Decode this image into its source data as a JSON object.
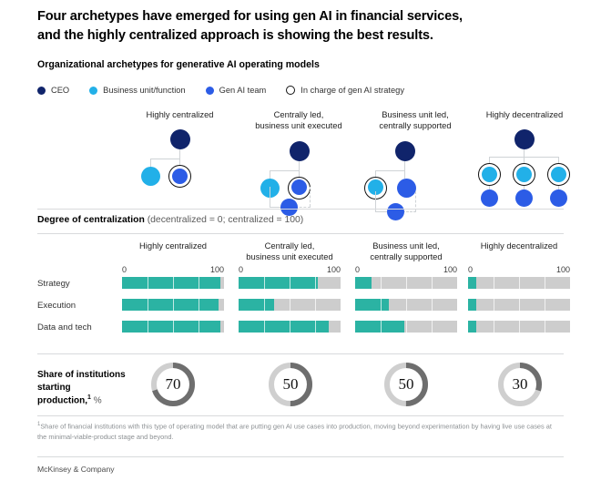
{
  "headline": {
    "line1": "Four archetypes have emerged for using gen AI in financial services,",
    "line2": "and the highly centralized approach is showing the best results."
  },
  "section1": {
    "title": "Organizational archetypes for generative AI operating models",
    "legend": [
      {
        "label": "CEO",
        "color": "#10246b",
        "style": "solid"
      },
      {
        "label": "Business unit/function",
        "color": "#22b0e8",
        "style": "solid"
      },
      {
        "label": "Gen AI team",
        "color": "#2c5ce6",
        "style": "solid"
      },
      {
        "label": "In charge of gen AI strategy",
        "color": "#ffffff",
        "style": "ring"
      }
    ],
    "archetypes": [
      {
        "name": "Highly centralized",
        "label_line1": "Highly centralized",
        "label_line2": ""
      },
      {
        "name": "Centrally led, business unit executed",
        "label_line1": "Centrally led,",
        "label_line2": "business unit executed"
      },
      {
        "name": "Business unit led, centrally supported",
        "label_line1": "Business unit led,",
        "label_line2": "centrally supported"
      },
      {
        "name": "Highly decentralized",
        "label_line1": "Highly decentralized",
        "label_line2": ""
      }
    ]
  },
  "section2": {
    "title_bold": "Degree of centralization",
    "title_rest": "(decentralized = 0; centralized = 100)",
    "axis_min_label": "0",
    "axis_max_label": "100"
  },
  "donut_section": {
    "title_line1": "Share of institutions",
    "title_line2": "starting",
    "title_line3": "production,",
    "title_sup": "1",
    "title_unit": "%",
    "track_color": "#cfcfcf",
    "value_color": "#6e6e6e",
    "values": [
      70,
      50,
      50,
      30
    ]
  },
  "footnote": {
    "marker": "1",
    "text": "Share of financial institutions with this type of operating model that are putting gen AI use cases into production, moving beyond experimentation by having live use cases at the minimal-viable-product stage and beyond."
  },
  "footer": {
    "brand": "McKinsey & Company"
  },
  "chart_data": {
    "type": "bar",
    "title": "Degree of centralization (decentralized = 0; centralized = 100)",
    "xlabel": "",
    "ylabel": "",
    "xlim": [
      0,
      100
    ],
    "grid": true,
    "legend_position": "none",
    "categories": [
      "Strategy",
      "Execution",
      "Data and tech"
    ],
    "panels": [
      {
        "name": "Highly centralized",
        "values": [
          96,
          95,
          96
        ]
      },
      {
        "name": "Centrally led, business unit executed",
        "values": [
          78,
          35,
          88
        ]
      },
      {
        "name": "Business unit led, centrally supported",
        "values": [
          16,
          33,
          48
        ]
      },
      {
        "name": "Highly decentralized",
        "values": [
          8,
          8,
          8
        ]
      }
    ],
    "donuts": {
      "type": "pie",
      "title": "Share of institutions starting production, %",
      "categories": [
        "Highly centralized",
        "Centrally led, business unit executed",
        "Business unit led, centrally supported",
        "Highly decentralized"
      ],
      "values": [
        70,
        50,
        50,
        30
      ]
    }
  }
}
